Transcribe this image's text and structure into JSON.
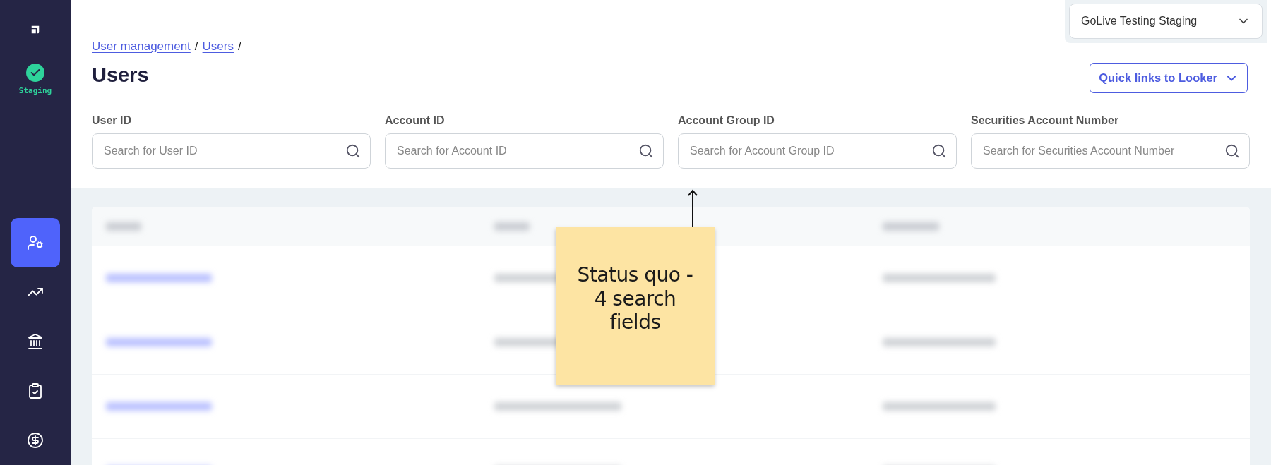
{
  "sidebar": {
    "environment": {
      "label": "Staging",
      "healthy": true
    },
    "items": [
      {
        "selected": true
      },
      {
        "selected": false
      },
      {
        "selected": false
      },
      {
        "selected": false
      },
      {
        "selected": false
      }
    ]
  },
  "workspace_select": {
    "value": "GoLive Testing Staging"
  },
  "breadcrumb": [
    {
      "label": "User management",
      "separator": "/"
    },
    {
      "label": "Users",
      "separator": "/"
    }
  ],
  "title": "Users",
  "quick_links_button": "Quick links to Looker",
  "search_fields": [
    {
      "label": "User ID",
      "placeholder": "Search for User ID"
    },
    {
      "label": "Account ID",
      "placeholder": "Search for Account ID"
    },
    {
      "label": "Account Group ID",
      "placeholder": "Search for Account Group ID"
    },
    {
      "label": "Securities Account Number",
      "placeholder": "Search for Securities Account Number"
    }
  ],
  "sticky_note": {
    "text": "Status quo -\n4 search\nfields"
  }
}
